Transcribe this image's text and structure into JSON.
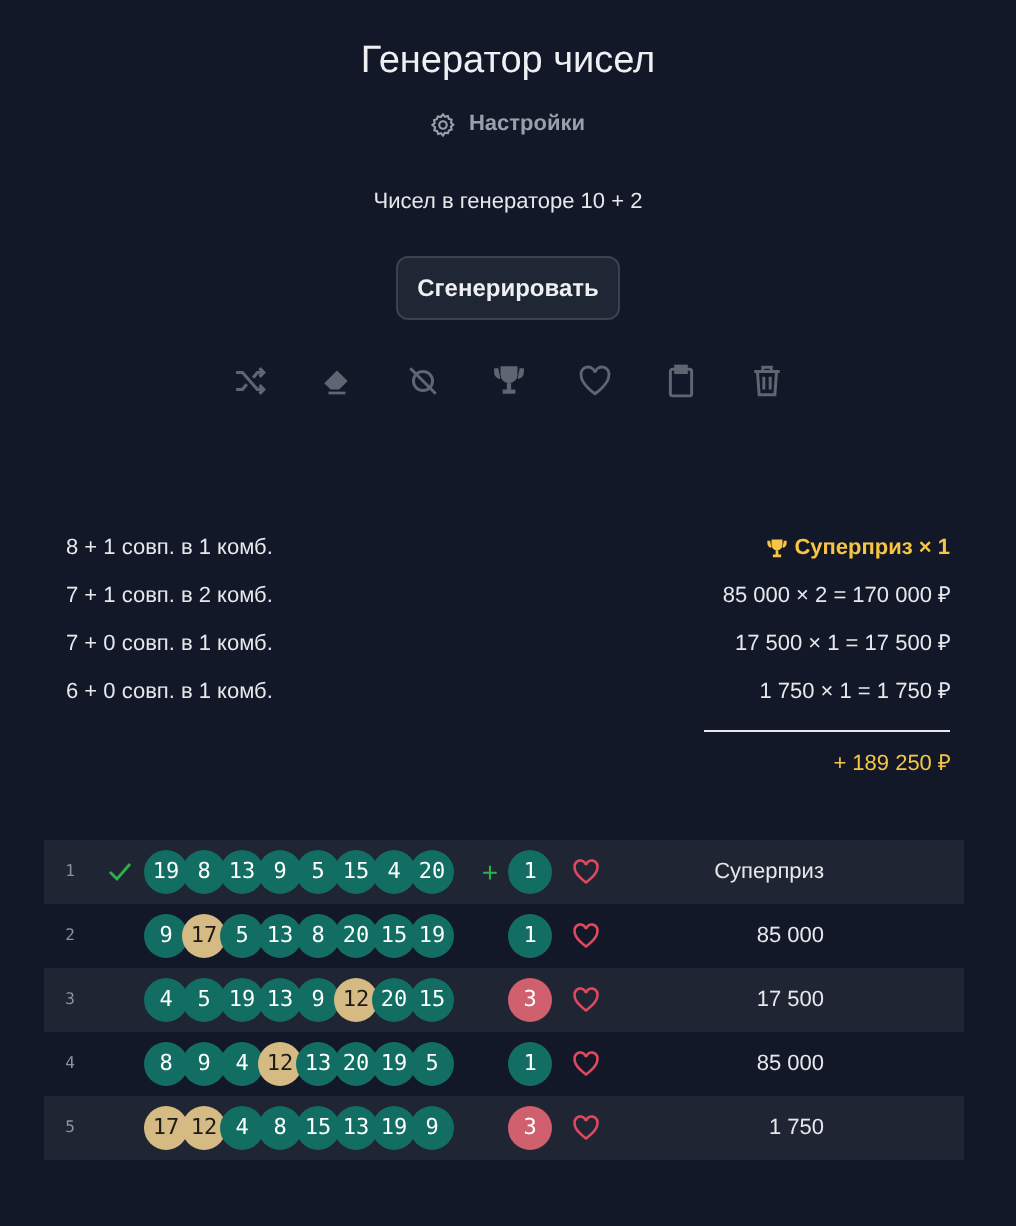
{
  "title": "Генератор чисел",
  "settings_link": "Настройки",
  "numbers_info": "Чисел в генераторе 10 + 2",
  "generate_button": "Сгенерировать",
  "summary": [
    {
      "matches": "8 + 1 совп. в 1 комб.",
      "result": "Суперприз × 1",
      "kind": "jackpot"
    },
    {
      "matches": "7 + 1 совп. в 2 комб.",
      "result": "85 000 × 2 = 170 000 ₽",
      "kind": "money"
    },
    {
      "matches": "7 + 0 совп. в 1 комб.",
      "result": "17 500 × 1 = 17 500 ₽",
      "kind": "money"
    },
    {
      "matches": "6 + 0 совп. в 1 комб.",
      "result": "1 750 × 1 = 1 750 ₽",
      "kind": "money"
    }
  ],
  "total": "+ 189 250 ₽",
  "rows": [
    {
      "index": "1",
      "winner": true,
      "separator": "+",
      "balls": [
        {
          "number": "19",
          "matched": true
        },
        {
          "number": "8",
          "matched": true
        },
        {
          "number": "13",
          "matched": true
        },
        {
          "number": "9",
          "matched": true
        },
        {
          "number": "5",
          "matched": true
        },
        {
          "number": "15",
          "matched": true
        },
        {
          "number": "4",
          "matched": true
        },
        {
          "number": "20",
          "matched": true
        }
      ],
      "bonus": {
        "number": "1",
        "matched": true
      },
      "favorite": false,
      "prize": "Суперприз"
    },
    {
      "index": "2",
      "winner": false,
      "balls": [
        {
          "number": "9",
          "matched": true
        },
        {
          "number": "17",
          "matched": false
        },
        {
          "number": "5",
          "matched": true
        },
        {
          "number": "13",
          "matched": true
        },
        {
          "number": "8",
          "matched": true
        },
        {
          "number": "20",
          "matched": true
        },
        {
          "number": "15",
          "matched": true
        },
        {
          "number": "19",
          "matched": true
        }
      ],
      "bonus": {
        "number": "1",
        "matched": true
      },
      "favorite": false,
      "prize": "85 000"
    },
    {
      "index": "3",
      "winner": false,
      "balls": [
        {
          "number": "4",
          "matched": true
        },
        {
          "number": "5",
          "matched": true
        },
        {
          "number": "19",
          "matched": true
        },
        {
          "number": "13",
          "matched": true
        },
        {
          "number": "9",
          "matched": true
        },
        {
          "number": "12",
          "matched": false
        },
        {
          "number": "20",
          "matched": true
        },
        {
          "number": "15",
          "matched": true
        }
      ],
      "bonus": {
        "number": "3",
        "matched": false
      },
      "favorite": false,
      "prize": "17 500"
    },
    {
      "index": "4",
      "winner": false,
      "balls": [
        {
          "number": "8",
          "matched": true
        },
        {
          "number": "9",
          "matched": true
        },
        {
          "number": "4",
          "matched": true
        },
        {
          "number": "12",
          "matched": false
        },
        {
          "number": "13",
          "matched": true
        },
        {
          "number": "20",
          "matched": true
        },
        {
          "number": "19",
          "matched": true
        },
        {
          "number": "5",
          "matched": true
        }
      ],
      "bonus": {
        "number": "1",
        "matched": true
      },
      "favorite": false,
      "prize": "85 000"
    },
    {
      "index": "5",
      "winner": false,
      "balls": [
        {
          "number": "17",
          "matched": false
        },
        {
          "number": "12",
          "matched": false
        },
        {
          "number": "4",
          "matched": true
        },
        {
          "number": "8",
          "matched": true
        },
        {
          "number": "15",
          "matched": true
        },
        {
          "number": "13",
          "matched": true
        },
        {
          "number": "19",
          "matched": true
        },
        {
          "number": "9",
          "matched": true
        }
      ],
      "bonus": {
        "number": "3",
        "matched": false
      },
      "favorite": false,
      "prize": "1 750"
    }
  ]
}
